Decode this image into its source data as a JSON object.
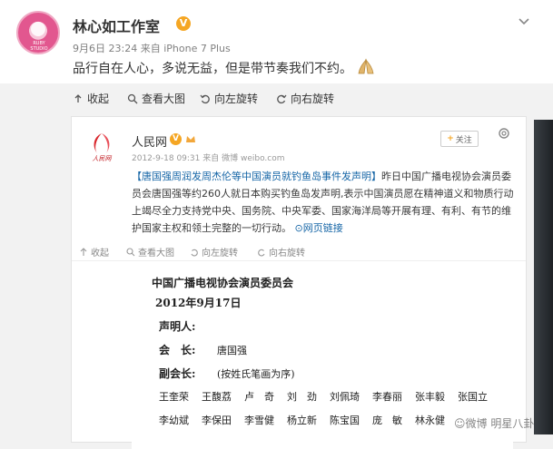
{
  "post": {
    "author": "林心如工作室",
    "time": "9月6日 23:24",
    "source_prefix": "来自",
    "source": "iPhone 7 Plus",
    "text": "品行自在人心，多说无益，但是带节奏我们不约。",
    "avatar_text": "RUBY STUDIO"
  },
  "toolbar": {
    "collapse": "收起",
    "view_large": "查看大图",
    "rotate_left": "向左旋转",
    "rotate_right": "向右旋转"
  },
  "repost": {
    "author": "人民网",
    "time": "2012-9-18 09:31",
    "source": "来自 微博 weibo.com",
    "follow": "关注",
    "bracket": "【唐国强周润发周杰伦等中国演员就钓鱼岛事件发声明】",
    "body": "昨日中国广播电视协会演员委员会唐国强等约260人就日本购买钓鱼岛发声明,表示中国演员愿在精神道义和物质行动上竭尽全力支持党中央、国务院、中央军委、国家海洋局等开展有理、有利、有节的维护国家主权和领土完整的一切行动。",
    "link": "网页链接",
    "toolbar": {
      "collapse": "收起",
      "view_large": "查看大图",
      "rotate_left": "向左旋转",
      "rotate_right": "向右旋转"
    }
  },
  "document": {
    "title": "中国广播电视协会演员委员会",
    "date": "2012年9月17日",
    "declarant_label": "声明人:",
    "president_label": "会　长:",
    "president_value": "唐国强",
    "vice_label": "副会长:",
    "vice_note": "(按姓氏笔画为序)",
    "names_row1": [
      "王奎荣",
      "王馥荔",
      "卢　奇",
      "刘　劲",
      "刘佩琦",
      "李春丽",
      "张丰毅",
      "张国立"
    ],
    "names_row2": [
      "李幼斌",
      "李保田",
      "李雪健",
      "杨立新",
      "陈宝国",
      "庞　敏",
      "林永健"
    ]
  },
  "watermark": "☺微博 明星八卦",
  "colors": {
    "badge": "#f5a623",
    "link": "#1565a6"
  }
}
